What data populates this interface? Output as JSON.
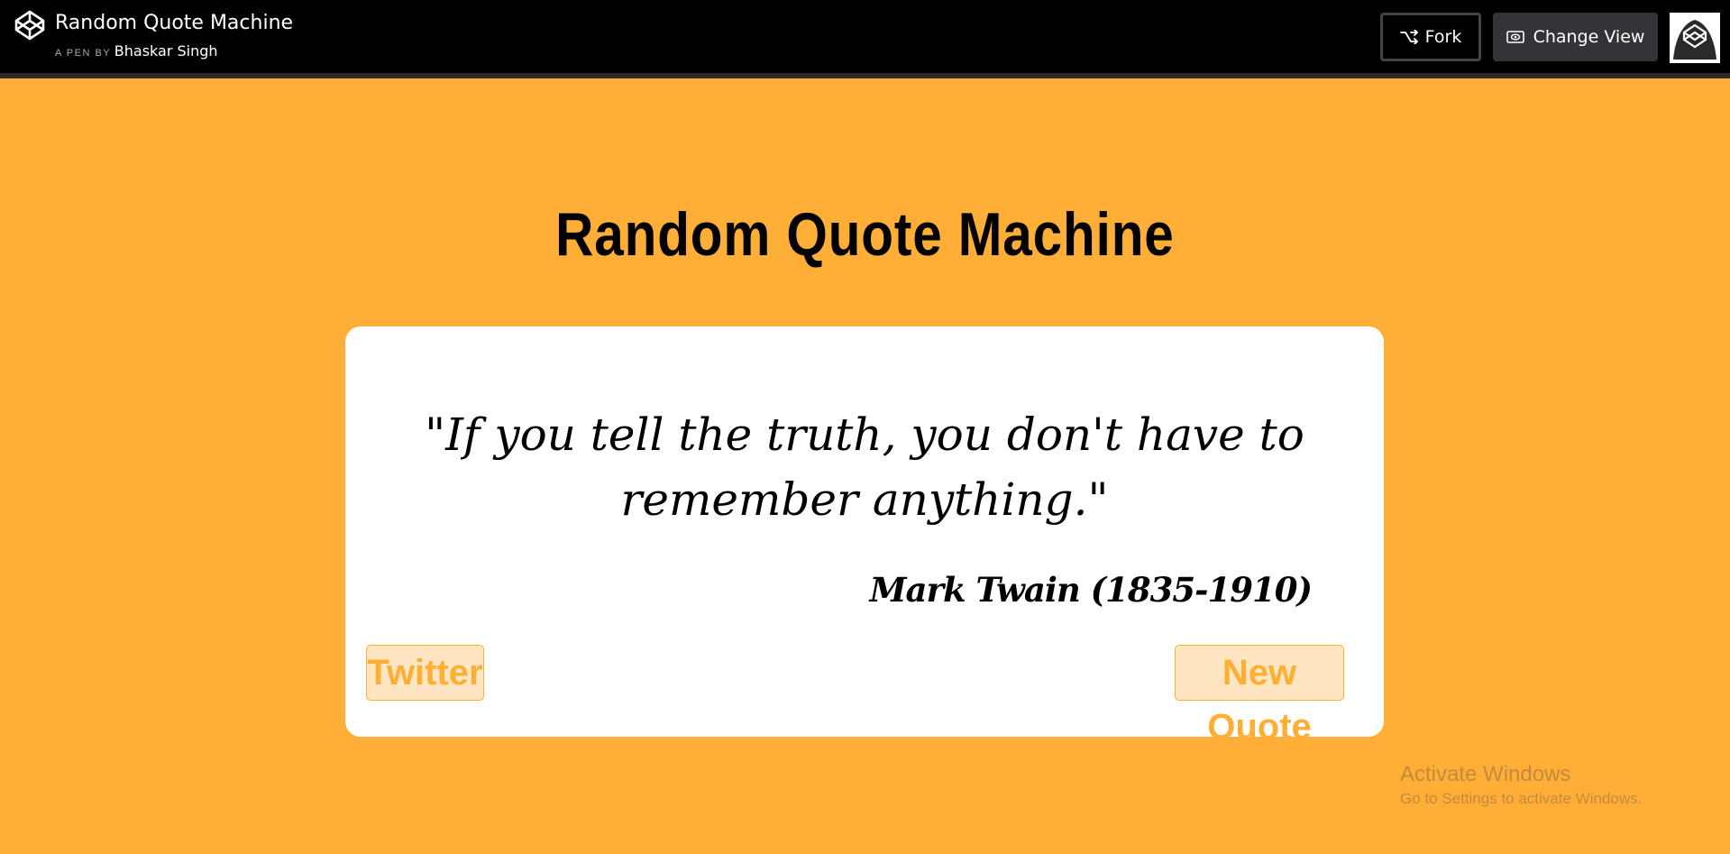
{
  "header": {
    "pen_title": "Random Quote Machine",
    "pen_by_prefix": "A PEN BY",
    "author": "Bhaskar Singh",
    "fork_label": "Fork",
    "change_view_label": "Change View",
    "logo_icon": "codepen-logo-icon",
    "fork_icon": "fork-icon",
    "change_view_icon": "eye-icon"
  },
  "main": {
    "heading": "Random Quote Machine",
    "quote_text": "\"If you tell the truth, you don't have to remember anything.\"",
    "quote_author": "Mark Twain (1835-1910)",
    "twitter_label": "Twitter",
    "new_quote_label": "New Quote"
  },
  "watermark": {
    "title": "Activate Windows",
    "subtitle": "Go to Settings to activate Windows."
  },
  "colors": {
    "background": "#ffae37",
    "topbar": "#000000",
    "card": "#ffffff",
    "button_text": "#ffae37",
    "button_bg": "#ffe6c0"
  }
}
